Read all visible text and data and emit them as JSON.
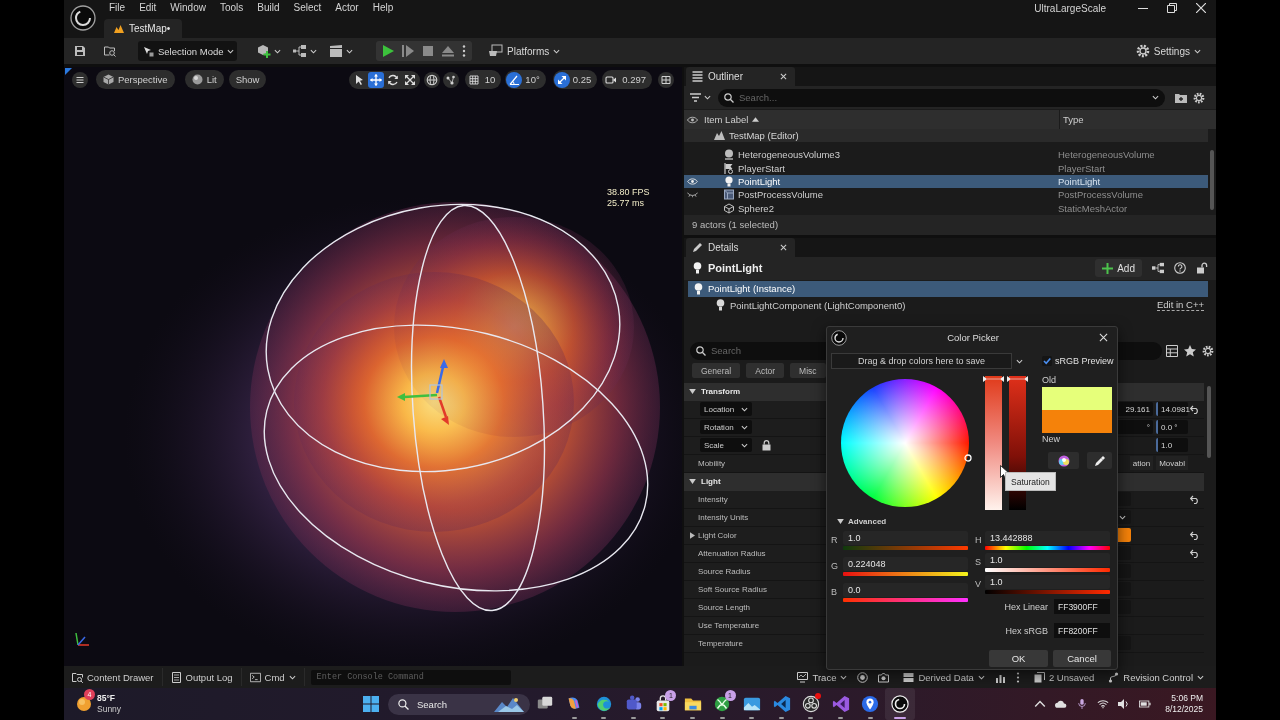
{
  "window": {
    "title": "UltraLargeScale",
    "menu": [
      "File",
      "Edit",
      "Window",
      "Tools",
      "Build",
      "Select",
      "Actor",
      "Help"
    ],
    "document_tab": "TestMap•"
  },
  "toolbar": {
    "mode": "Selection Mode",
    "platforms": "Platforms",
    "settings": "Settings"
  },
  "viewport": {
    "view_options": [
      {
        "label": "Perspective",
        "kind": "camera"
      },
      {
        "label": "Lit",
        "kind": "lighting"
      },
      {
        "label": "Show",
        "kind": "plain"
      }
    ],
    "tools": [
      {
        "kind": "select",
        "selected": false
      },
      {
        "kind": "translate",
        "selected": true
      },
      {
        "kind": "rotate",
        "selected": false
      },
      {
        "kind": "scale",
        "selected": false
      }
    ],
    "snaps": [
      {
        "kind": "grid",
        "value": "10",
        "on": false
      },
      {
        "kind": "angle",
        "value": "10°",
        "on": true
      },
      {
        "kind": "scale",
        "value": "0.25",
        "on": true
      },
      {
        "kind": "camera",
        "value": "0.297",
        "on": false
      }
    ],
    "stats": [
      "38.80 FPS",
      "25.77 ms"
    ]
  },
  "outliner": {
    "title": "Outliner",
    "search": {
      "placeholder": "Search..."
    },
    "columns": [
      {
        "label": "Item Label",
        "sorted": true
      },
      {
        "label": "Type",
        "sorted": false
      }
    ],
    "tree": {
      "label": "TestMap (Editor)",
      "selected": false,
      "children": [
        {
          "label": "HeterogeneousVolume3",
          "type": "HeterogeneousVolume",
          "kind": "volume",
          "selected": false,
          "hidden": false
        },
        {
          "label": "PlayerStart",
          "type": "PlayerStart",
          "kind": "player-start",
          "selected": false,
          "hidden": false
        },
        {
          "label": "PointLight",
          "type": "PointLight",
          "kind": "light",
          "selected": true,
          "hidden": false
        },
        {
          "label": "PostProcessVolume",
          "type": "PostProcessVolume",
          "kind": "post-process",
          "selected": false,
          "hidden": true
        },
        {
          "label": "Sphere2",
          "type": "StaticMeshActor",
          "kind": "mesh",
          "selected": false,
          "hidden": false
        }
      ]
    },
    "status": "9 actors (1 selected)"
  },
  "details": {
    "title": "Details",
    "actor": "PointLight",
    "add_button": "Add",
    "components": [
      {
        "label": "PointLight (Instance)",
        "selected": true,
        "children": [
          {
            "label": "PointLightComponent (LightComponent0)",
            "selected": false,
            "link": "Edit in C++"
          }
        ]
      }
    ],
    "search": {
      "placeholder": "Search"
    },
    "filters": [
      "General",
      "Actor",
      "Misc"
    ],
    "sections": [
      {
        "title": "Transform",
        "expanded": true,
        "properties": [
          {
            "label": "Location",
            "kind": "numbers",
            "selector": true,
            "values": [
              "29.161",
              "14.0981"
            ],
            "reset": true
          },
          {
            "label": "Rotation",
            "kind": "numbers",
            "selector": true,
            "values": [
              "°",
              "0.0 °"
            ],
            "reset": false
          },
          {
            "label": "Scale",
            "kind": "numbers",
            "selector": true,
            "locked": true,
            "values": [
              "1.0"
            ],
            "reset": false
          },
          {
            "label": "Mobility",
            "kind": "segments",
            "values": [
              "ation",
              "Movabl"
            ],
            "reset": false
          }
        ]
      },
      {
        "title": "Light",
        "expanded": true,
        "properties": [
          {
            "label": "Intensity",
            "kind": "field",
            "reset": true
          },
          {
            "label": "Intensity Units",
            "kind": "dropdown",
            "reset": false
          },
          {
            "label": "Light Color",
            "kind": "color",
            "color": "#f5820a",
            "expanded": false,
            "reset": true
          },
          {
            "label": "Attenuation Radius",
            "kind": "field",
            "reset": true
          },
          {
            "label": "Source Radius",
            "kind": "field",
            "reset": false
          },
          {
            "label": "Soft Source Radius",
            "kind": "field",
            "reset": false
          },
          {
            "label": "Source Length",
            "kind": "field",
            "reset": false
          },
          {
            "label": "Use Temperature",
            "kind": "none",
            "reset": false
          },
          {
            "label": "Temperature",
            "kind": "field",
            "reset": false
          }
        ]
      }
    ]
  },
  "color_picker": {
    "title": "Color Picker",
    "drop_hint": "Drag & drop colors here to save",
    "srgb_preview": {
      "label": "sRGB Preview",
      "checked": true
    },
    "saturation": {
      "level": 1
    },
    "value": {
      "level": 1
    },
    "tooltip": "Saturation",
    "swatches": [
      {
        "label": "Old",
        "color": "#e6ff7a"
      },
      {
        "label": "New",
        "color": "#f5820a"
      }
    ],
    "advanced": {
      "label": "Advanced",
      "expanded": true
    },
    "rgb": [
      {
        "label": "R",
        "value": "1.0",
        "kind": "r"
      },
      {
        "label": "G",
        "value": "0.224048",
        "kind": "g"
      },
      {
        "label": "B",
        "value": "0.0",
        "kind": "b"
      }
    ],
    "hsv": [
      {
        "label": "H",
        "value": "13.442888",
        "kind": "h"
      },
      {
        "label": "S",
        "value": "1.0",
        "kind": "s"
      },
      {
        "label": "V",
        "value": "1.0",
        "kind": "v"
      }
    ],
    "hex": [
      {
        "label": "Hex Linear",
        "value": "FF3900FF"
      },
      {
        "label": "Hex sRGB",
        "value": "FF8200FF"
      }
    ],
    "buttons": [
      "OK",
      "Cancel"
    ]
  },
  "status_bar": {
    "left": [
      {
        "label": "Content Drawer",
        "kind": "drawer"
      },
      {
        "label": "Output Log",
        "kind": "log"
      },
      {
        "label": "Cmd",
        "kind": "cmd"
      }
    ],
    "console": {
      "placeholder": "Enter Console Command"
    },
    "right": [
      {
        "label": "Trace",
        "kind": "trace"
      },
      {
        "kind": "record"
      },
      {
        "kind": "capture"
      },
      {
        "label": "Derived Data",
        "kind": "data"
      },
      {
        "kind": "stats"
      },
      {
        "kind": "more"
      },
      {
        "label": "2 Unsaved",
        "kind": "unsaved"
      },
      {
        "label": "Revision Control",
        "kind": "revision"
      }
    ]
  },
  "taskbar": {
    "weather": {
      "badge": "4",
      "temperature": "85°F",
      "condition": "Sunny"
    },
    "search_button": "Search",
    "apps": [
      {
        "kind": "task-view",
        "running": false,
        "selected": false,
        "alert": false
      },
      {
        "kind": "copilot",
        "running": true,
        "selected": false,
        "alert": false
      },
      {
        "kind": "edge",
        "running": true,
        "selected": false,
        "alert": false
      },
      {
        "kind": "teams",
        "running": true,
        "selected": false,
        "alert": false
      },
      {
        "kind": "store",
        "running": true,
        "selected": false,
        "alert": false,
        "badge": "1"
      },
      {
        "kind": "files",
        "running": true,
        "selected": false,
        "alert": false
      },
      {
        "kind": "xbox",
        "running": true,
        "selected": false,
        "alert": false,
        "badge": "1"
      },
      {
        "kind": "photos",
        "running": true,
        "selected": false,
        "alert": false
      },
      {
        "kind": "vscode",
        "running": true,
        "selected": false,
        "alert": false
      },
      {
        "kind": "obs",
        "running": true,
        "selected": false,
        "alert": true
      },
      {
        "kind": "visual-studio",
        "running": true,
        "selected": false,
        "alert": false
      },
      {
        "kind": "maps",
        "running": true,
        "selected": false,
        "alert": false
      },
      {
        "kind": "unreal",
        "running": true,
        "selected": true,
        "alert": false
      }
    ],
    "time": "5:06 PM",
    "date": "8/12/2025"
  }
}
